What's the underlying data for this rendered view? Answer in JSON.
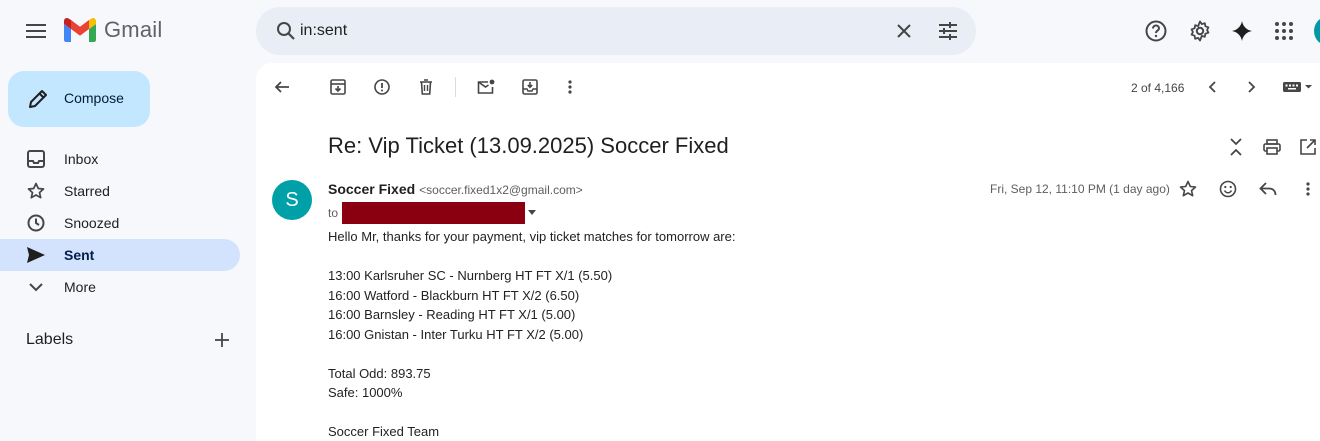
{
  "app": {
    "name": "Gmail"
  },
  "search": {
    "value": "in:sent"
  },
  "compose": {
    "label": "Compose"
  },
  "nav": [
    {
      "label": "Inbox",
      "icon": "inbox-icon",
      "active": false
    },
    {
      "label": "Starred",
      "icon": "star-icon",
      "active": false
    },
    {
      "label": "Snoozed",
      "icon": "clock-icon",
      "active": false
    },
    {
      "label": "Sent",
      "icon": "send-icon",
      "active": true
    },
    {
      "label": "More",
      "icon": "chevron-down-icon",
      "active": false
    }
  ],
  "labels": {
    "title": "Labels"
  },
  "toolbar": {
    "pager": "2 of 4,166"
  },
  "email": {
    "subject": "Re: Vip Ticket (13.09.2025) Soccer Fixed",
    "avatar_letter": "S",
    "sender_name": "Soccer Fixed",
    "sender_email": "<soccer.fixed1x2@gmail.com>",
    "to_label": "to",
    "date": "Fri, Sep 12, 11:10 PM (1 day ago)",
    "body": {
      "greeting": "Hello Mr, thanks for your payment, vip ticket matches for tomorrow are:",
      "matches": [
        "13:00 Karlsruher SC - Nurnberg HT FT X/1 (5.50)",
        "16:00 Watford - Blackburn HT FT X/2 (6.50)",
        "16:00 Barnsley - Reading HT FT X/1 (5.00)",
        "16:00 Gnistan - Inter Turku HT FT X/2 (5.00)"
      ],
      "total_odd": "Total Odd: 893.75",
      "safe": "Safe: 1000%",
      "signature": "Soccer Fixed Team"
    }
  },
  "colors": {
    "accent": "#c2e7ff",
    "active_nav": "#d3e3fd",
    "avatar": "#00a0a8",
    "redaction": "#8b0010"
  }
}
